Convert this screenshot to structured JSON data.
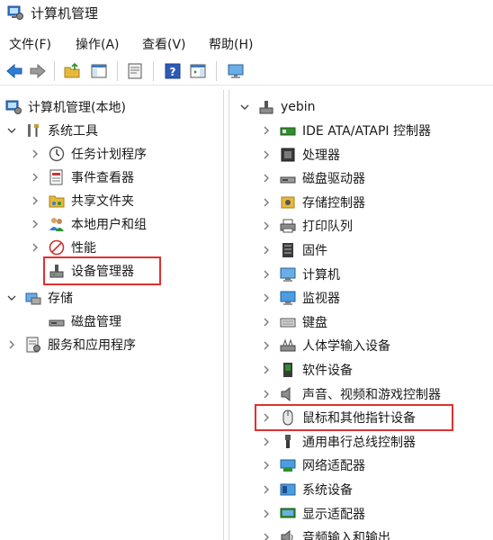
{
  "window": {
    "title": "计算机管理"
  },
  "menu": [
    "文件(F)",
    "操作(A)",
    "查看(V)",
    "帮助(H)"
  ],
  "toolbar": {
    "buttons": [
      "back-icon",
      "forward-icon",
      "up-folder-icon",
      "show-hide-tree-icon",
      "properties-icon",
      "help-icon",
      "show-action-pane-icon",
      "monitor-icon"
    ]
  },
  "left_tree": {
    "root": "计算机管理(本地)",
    "system_tools": "系统工具",
    "task_scheduler": "任务计划程序",
    "event_viewer": "事件查看器",
    "shared_folders": "共享文件夹",
    "local_users": "本地用户和组",
    "performance": "性能",
    "device_manager": "设备管理器",
    "storage": "存储",
    "disk_management": "磁盘管理",
    "services_apps": "服务和应用程序"
  },
  "right_tree": {
    "root": "yebin",
    "items": [
      "IDE ATA/ATAPI 控制器",
      "处理器",
      "磁盘驱动器",
      "存储控制器",
      "打印队列",
      "固件",
      "计算机",
      "监视器",
      "键盘",
      "人体学输入设备",
      "软件设备",
      "声音、视频和游戏控制器",
      "鼠标和其他指针设备",
      "通用串行总线控制器",
      "网络适配器",
      "系统设备",
      "显示适配器",
      "音频输入和输出"
    ]
  },
  "colors": {
    "highlight": "#e0312f",
    "selection": "#cce4f7"
  }
}
